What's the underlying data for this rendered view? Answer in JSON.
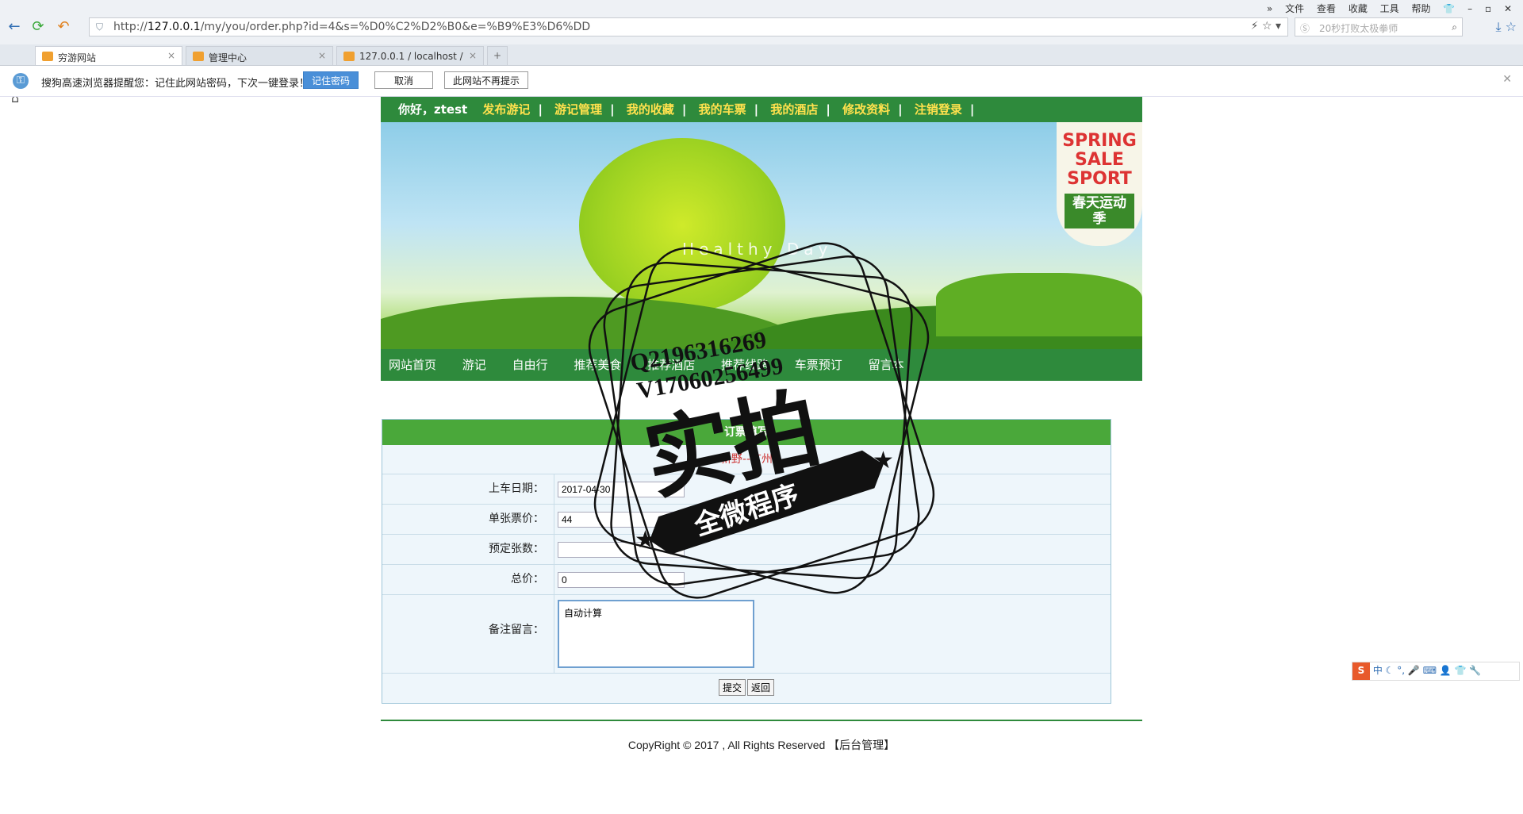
{
  "browser": {
    "url_prefix": "http://",
    "url_host": "127.0.0.1",
    "url_path": "/my/you/order.php?id=4&s=%D0%C2%D2%B0&e=%B9%E3%D6%DD",
    "search_placeholder": "20秒打败太极拳师",
    "menu": [
      "文件",
      "查看",
      "收藏",
      "工具",
      "帮助"
    ],
    "tabs": [
      {
        "label": "穷游网站",
        "close": "×"
      },
      {
        "label": "管理中心",
        "close": "×"
      },
      {
        "label": "127.0.0.1 / localhost /",
        "close": "×"
      }
    ],
    "new_tab": "+"
  },
  "notification": {
    "message": "搜狗高速浏览器提醒您：记住此网站密码，下次一键登录！",
    "remember": "记住密码",
    "cancel": "取消",
    "never": "此网站不再提示"
  },
  "topnav": {
    "greeting": "你好，ztest",
    "items": [
      "发布游记",
      "游记管理",
      "我的收藏",
      "我的车票",
      "我的酒店",
      "修改资料",
      "注销登录"
    ],
    "sep": "|"
  },
  "banner": {
    "sale_lines": [
      "SPRING",
      "SALE",
      "SPORT"
    ],
    "sale_cn": "春天运动季",
    "slogan": "Healthy Day"
  },
  "mainnav": [
    "网站首页",
    "游记",
    "自由行",
    "推荐美食",
    "推荐酒店",
    "推荐线路",
    "车票预订",
    "留言本"
  ],
  "form": {
    "title": "订票填写",
    "route": "新野--广州",
    "fields": [
      {
        "label": "上车日期：",
        "value": "2017-04-30"
      },
      {
        "label": "单张票价：",
        "value": "44"
      },
      {
        "label": "预定张数：",
        "value": ""
      },
      {
        "label": "总价：",
        "value": "0"
      }
    ],
    "remark_label": "备注留言：",
    "remark_value": "自动计算",
    "submit": "提交",
    "back": "返回"
  },
  "footer": {
    "copyright": "CopyRight © 2017 , All Rights Reserved",
    "admin": "【后台管理】"
  },
  "watermark": {
    "line1": "Q2196316269",
    "line2": "V17060256499",
    "main": "实拍",
    "ribbon": "全微程序"
  },
  "ime": {
    "logo": "S",
    "mode": "中"
  }
}
